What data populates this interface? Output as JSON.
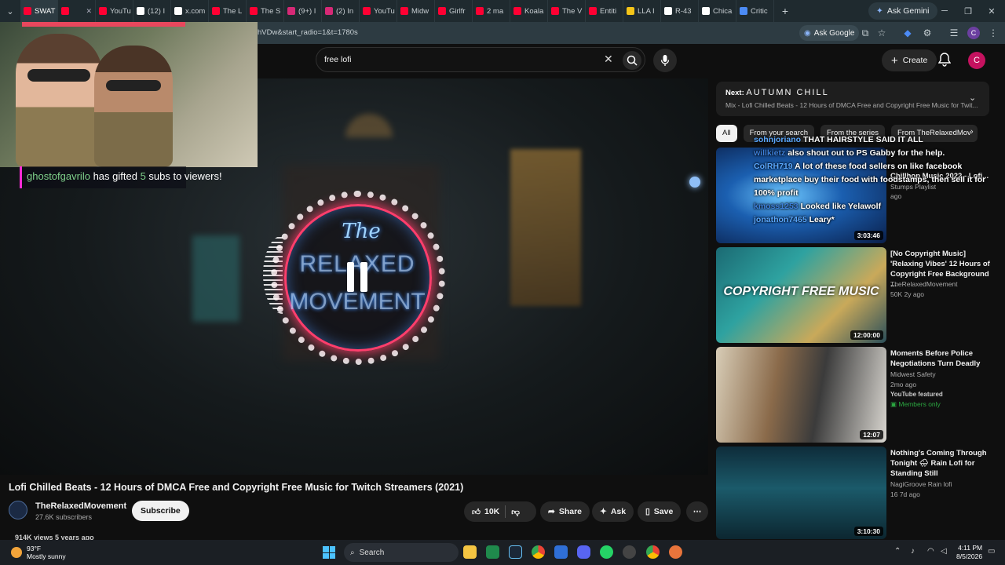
{
  "browser": {
    "tabs": [
      {
        "label": "SWAT",
        "favicon_color": "#ff0033",
        "active": true
      },
      {
        "label": "",
        "favicon_color": "#ff0033",
        "active": false
      },
      {
        "label": "YouTu",
        "favicon_color": "#ff0033",
        "active": false
      },
      {
        "label": "(12) I",
        "favicon_color": "#ffffff",
        "active": false
      },
      {
        "label": "x.com",
        "favicon_color": "#ffffff",
        "active": false
      },
      {
        "label": "The L",
        "favicon_color": "#ff0033",
        "active": false
      },
      {
        "label": "The S",
        "favicon_color": "#ff0033",
        "active": false
      },
      {
        "label": "(9+) I",
        "favicon_color": "#d62976",
        "active": false
      },
      {
        "label": "(2) In",
        "favicon_color": "#d62976",
        "active": false
      },
      {
        "label": "YouTu",
        "favicon_color": "#ff0033",
        "active": false
      },
      {
        "label": "Midw",
        "favicon_color": "#ff0033",
        "active": false
      },
      {
        "label": "Girlfr",
        "favicon_color": "#ff0033",
        "active": false
      },
      {
        "label": "2 ma",
        "favicon_color": "#ff0033",
        "active": false
      },
      {
        "label": "Koala",
        "favicon_color": "#ff0033",
        "active": false
      },
      {
        "label": "The V",
        "favicon_color": "#ff0033",
        "active": false
      },
      {
        "label": "Entiti",
        "favicon_color": "#ff0033",
        "active": false
      },
      {
        "label": "LLA I",
        "favicon_color": "#f5c518",
        "active": false
      },
      {
        "label": "R-43",
        "favicon_color": "#ffffff",
        "active": false
      },
      {
        "label": "Chica",
        "favicon_color": "#ffffff",
        "active": false
      },
      {
        "label": "Critic",
        "favicon_color": "#4c8bf5",
        "active": false
      }
    ],
    "ask_gemini": "Ask Gemini",
    "url_fragment": "hVDw&start_radio=1&t=1780s",
    "ask_google": "Ask Google",
    "profile_initial": "C"
  },
  "youtube": {
    "search_value": "free lofi",
    "create_label": "Create",
    "avatar_initial": "C"
  },
  "player": {
    "gift": {
      "user": "ghostofgavrilo",
      "middle": " has gifted ",
      "count": "5",
      "tail": " subs to viewers!"
    },
    "logo_the": "The",
    "logo_relaxed": "RELAXED",
    "logo_movement": "MOVEMENT"
  },
  "video": {
    "title": "Lofi Chilled Beats - 12 Hours of DMCA Free and Copyright Free Music for Twitch Streamers (2021)",
    "channel": "TheRelaxedMovement",
    "subscribers": "27.6K subscribers",
    "subscribe_label": "Subscribe",
    "likes": "10K",
    "share_label": "Share",
    "ask_label": "Ask",
    "save_label": "Save",
    "views_line": "914K views  5 years ago"
  },
  "sidebar": {
    "next_label": "Next:",
    "next_title": "AUTUMN CHILL",
    "next_sub": "Mix - Lofi Chilled Beats - 12 Hours of DMCA Free and Copyright Free Music for Twit...",
    "chips": [
      "All",
      "From your search",
      "From the series",
      "From TheRelaxedMov"
    ],
    "recommendations": [
      {
        "title": "Chillhop Music 2022 - Lofi...",
        "meta1": "Stumps Playlist",
        "meta2": "ago",
        "duration": "3:03:46"
      },
      {
        "title": "[No Copyright Music] 'Relaxing Vibes' 12 Hours of Copyright Free Background ...",
        "meta1": "TheRelaxedMovement",
        "meta2": "50K  2y ago",
        "duration": "12:00:00",
        "thumb_text": "COPYRIGHT FREE MUSIC"
      },
      {
        "title": "Moments Before Police Negotiations Turn Deadly",
        "meta1": "Midwest Safety",
        "meta2": "2mo ago",
        "featured": "YouTube featured",
        "members": "Members only",
        "duration": "12:07"
      },
      {
        "title": "Nothing's Coming Through Tonight 🌧 Rain Lofi for Standing Still",
        "meta1": "NagiGroove Rain lofi",
        "meta2": "16  7d ago",
        "duration": "3:10:30"
      }
    ]
  },
  "chat_overlay": [
    {
      "user": "sohnjoriano",
      "text": "THAT HAIRSTYLE SAID IT ALL"
    },
    {
      "user": "willkietz",
      "text": "also shout out to PS Gabby for the help."
    },
    {
      "user": "ColRH719",
      "text": "A lot of these food sellers on like facebook marketplace buy their food with foodstamps, then sell it for 100% profit"
    },
    {
      "user": "kmoss1253",
      "text": "Looked like Yelawolf"
    },
    {
      "user": "jonathon7465",
      "text": "Leary*"
    }
  ],
  "taskbar": {
    "temp": "93°F",
    "weather": "Mostly sunny",
    "search_label": "Search",
    "time": "4:11 PM",
    "date": "8/5/2026"
  }
}
